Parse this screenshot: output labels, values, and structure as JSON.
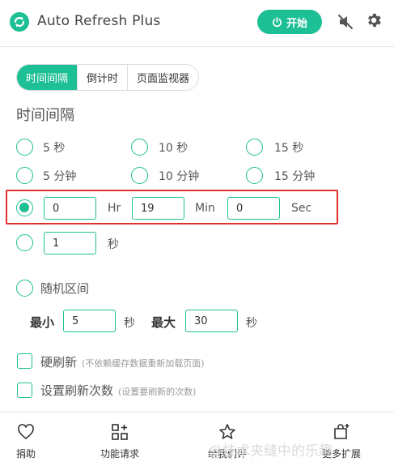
{
  "header": {
    "app_title": "Auto Refresh Plus",
    "start_label": "开始"
  },
  "tabs": [
    {
      "label": "时间间隔",
      "active": true
    },
    {
      "label": "倒计时",
      "active": false
    },
    {
      "label": "页面监视器",
      "active": false
    }
  ],
  "section_title": "时间间隔",
  "presets": [
    {
      "label": "5 秒"
    },
    {
      "label": "10 秒"
    },
    {
      "label": "15 秒"
    },
    {
      "label": "5 分钟"
    },
    {
      "label": "10 分钟"
    },
    {
      "label": "15 分钟"
    }
  ],
  "custom_time": {
    "hr_value": "0",
    "hr_unit": "Hr",
    "min_value": "19",
    "min_unit": "Min",
    "sec_value": "0",
    "sec_unit": "Sec"
  },
  "seconds_option": {
    "value": "1",
    "unit": "秒"
  },
  "random": {
    "label": "随机区间",
    "min_label": "最小",
    "min_value": "5",
    "min_unit": "秒",
    "max_label": "最大",
    "max_value": "30",
    "max_unit": "秒"
  },
  "hard_refresh": {
    "label": "硬刷新",
    "hint": "(不依赖缓存数据重新加载页面)"
  },
  "refresh_count": {
    "label": "设置刷新次数",
    "hint": "(设置要刷新的次数)"
  },
  "footer": {
    "donate": "捐助",
    "feature_request": "功能请求",
    "rate": "给我们评",
    "more": "更多扩展"
  },
  "watermark": "@技术夹缝中的乐趣",
  "colors": {
    "accent": "#1dbf94",
    "highlight": "#e0322b"
  }
}
